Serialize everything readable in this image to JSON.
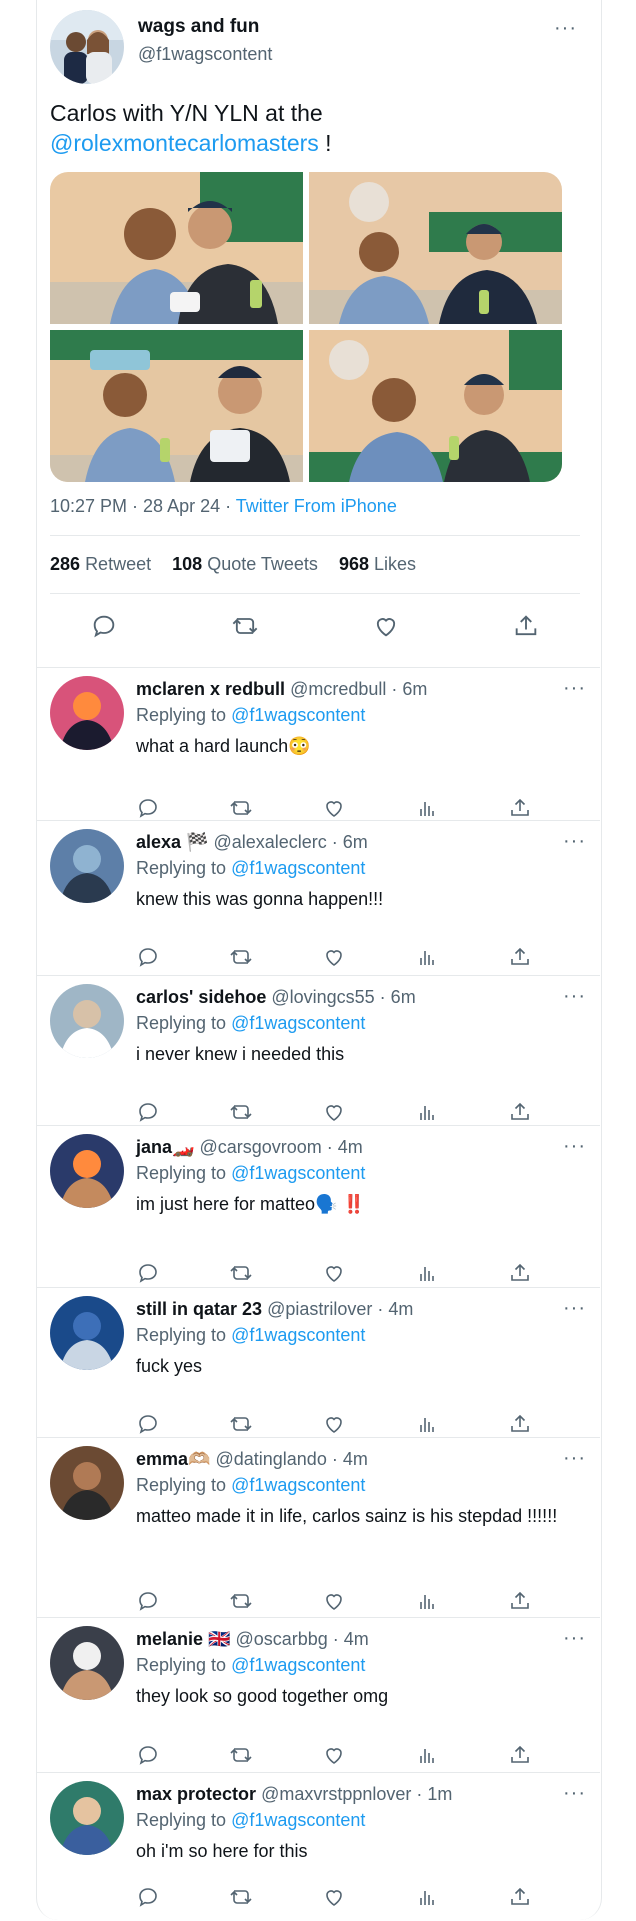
{
  "tweet": {
    "name": "wags and fun",
    "handle": "@f1wagscontent",
    "text": "Carlos with Y/N YLN at the",
    "mention": "@rolexmontecarlomasters",
    "text_end": " !",
    "time": "10:27 PM · 28 Apr 24 · ",
    "source": "Twitter From iPhone",
    "stats": [
      {
        "count": "286",
        "label": "Retweet"
      },
      {
        "count": "108",
        "label": "Quote Tweets"
      },
      {
        "count": "968",
        "label": "Likes"
      }
    ],
    "more": "···"
  },
  "replies": [
    {
      "name": "mclaren x redbull",
      "handle": "@mcredbull · 6m",
      "replying": "Replying to",
      "to": "@f1wagscontent",
      "text": "what a hard launch😳"
    },
    {
      "name": "alexa 🏁",
      "handle": "@alexaleclerc · 6m",
      "replying": "Replying to",
      "to": "@f1wagscontent",
      "text": "knew this was gonna happen!!!"
    },
    {
      "name": "carlos' sidehoe",
      "handle": "@lovingcs55 · 6m",
      "replying": "Replying to",
      "to": "@f1wagscontent",
      "text": "i never knew i needed this"
    },
    {
      "name": "jana🏎️",
      "handle": "@carsgovroom · 4m",
      "replying": "Replying to",
      "to": "@f1wagscontent",
      "text": "im just here for matteo🗣️ ‼️"
    },
    {
      "name": "still in qatar 23",
      "handle": "@piastrilover · 4m",
      "replying": "Replying to",
      "to": "@f1wagscontent",
      "text": "fuck yes"
    },
    {
      "name": "emma🫶🏼",
      "handle": "@datinglando · 4m",
      "replying": "Replying to",
      "to": "@f1wagscontent",
      "text": "matteo made it in life, carlos sainz is his stepdad !!!!!!"
    },
    {
      "name": "melanie 🇬🇧",
      "handle": "@oscarbbg · 4m",
      "replying": "Replying to",
      "to": "@f1wagscontent",
      "text": "they look so good together omg"
    },
    {
      "name": "max protector",
      "handle": "@maxvrstppnlover · 1m",
      "replying": "Replying to",
      "to": "@f1wagscontent",
      "text": "oh i'm so here for this"
    }
  ],
  "colors": {
    "accent": "#1d9bf0",
    "muted": "#536471",
    "border": "#e6e9eb"
  }
}
